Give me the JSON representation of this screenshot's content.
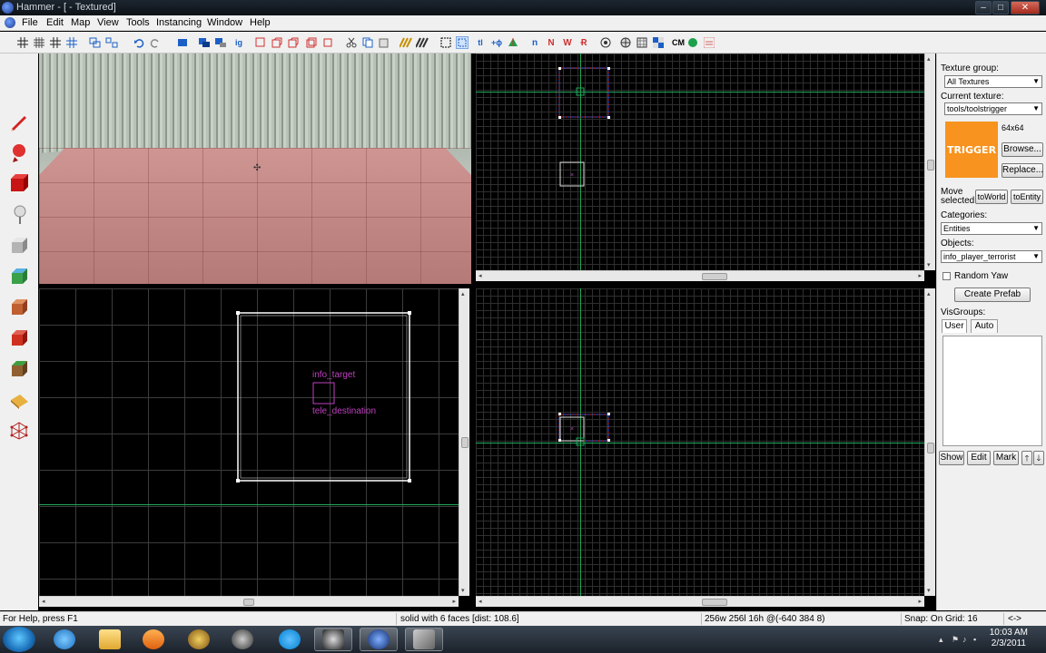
{
  "window": {
    "title": "Hammer - [ - Textured]",
    "buttons": {
      "minimize": "–",
      "maximize": "□",
      "close": "✕"
    }
  },
  "menubar": {
    "items": [
      "File",
      "Edit",
      "Map",
      "View",
      "Tools",
      "Instancing",
      "Window",
      "Help"
    ]
  },
  "toolbar": {
    "icons": [
      "grid-toggle-icon",
      "grid-3d-icon",
      "grid-smaller-icon",
      "grid-larger-icon",
      "group-icon",
      "ungroup-icon",
      "undo-icon",
      "redo-icon",
      "carve-icon",
      "hide-icon",
      "show-icon",
      "snap-icon",
      "cut-icon",
      "copy-icon",
      "paste-icon",
      "texture-lock-icon",
      "select-icon",
      "zoom-icon",
      "texture-icon",
      "decal-icon",
      "overlay-icon",
      "entity-icon",
      "path-icon",
      "vertex-icon",
      "face-icon",
      "compile-icon",
      "run-icon",
      "cordon-icon",
      "cubemap-icon",
      "bsp-icon",
      "no-draw-icon"
    ],
    "text_buttons": {
      "cm": "CM"
    }
  },
  "left_tools": [
    "pencil-icon",
    "magnify-icon",
    "camera-icon",
    "selection-icon",
    "block-icon",
    "texture-apply-icon",
    "entity-icon",
    "decal-icon",
    "overlay-icon",
    "clip-icon",
    "vertex-icon"
  ],
  "viewports": {
    "top_left_2d": {},
    "bottom_left_2d": {
      "labels": {
        "entity_name": "info_target",
        "target_name": "tele_destination"
      }
    }
  },
  "right_panel": {
    "texture_group_label": "Texture group:",
    "texture_group_value": "All Textures",
    "current_texture_label": "Current texture:",
    "current_texture_value": "tools/toolstrigger",
    "texture_size": "64x64",
    "texture_preview_text": "TRIGGER",
    "browse_button": "Browse...",
    "replace_button": "Replace...",
    "move_selected_label": "Move selected:",
    "to_world_button": "toWorld",
    "to_entity_button": "toEntity",
    "categories_label": "Categories:",
    "categories_value": "Entities",
    "objects_label": "Objects:",
    "objects_value": "info_player_terrorist",
    "random_yaw_label": "Random Yaw",
    "random_yaw_checked": false,
    "create_prefab_button": "Create Prefab",
    "visgroups_label": "VisGroups:",
    "tabs": [
      "User",
      "Auto"
    ],
    "show_button": "Show",
    "edit_button": "Edit",
    "mark_button": "Mark",
    "up_button": "🡑",
    "down_button": "🡓"
  },
  "statusbar": {
    "help": "For Help, press F1",
    "selection": "solid with 6 faces",
    "dist": "[dist: 108.6]",
    "dimensions": "256w 256l 16h @(-640 384 8)",
    "snap": "Snap: On Grid: 16",
    "extra": "<->"
  },
  "taskbar": {
    "apps": [
      "explorer-icon",
      "internet-explorer-icon",
      "folder-icon",
      "media-player-icon",
      "wow-icon",
      "steam-icon",
      "skype-icon",
      "steam-alt-icon",
      "worldcraft-icon",
      "hammer-icon"
    ],
    "time": "10:03 AM",
    "date": "2/3/2011"
  }
}
